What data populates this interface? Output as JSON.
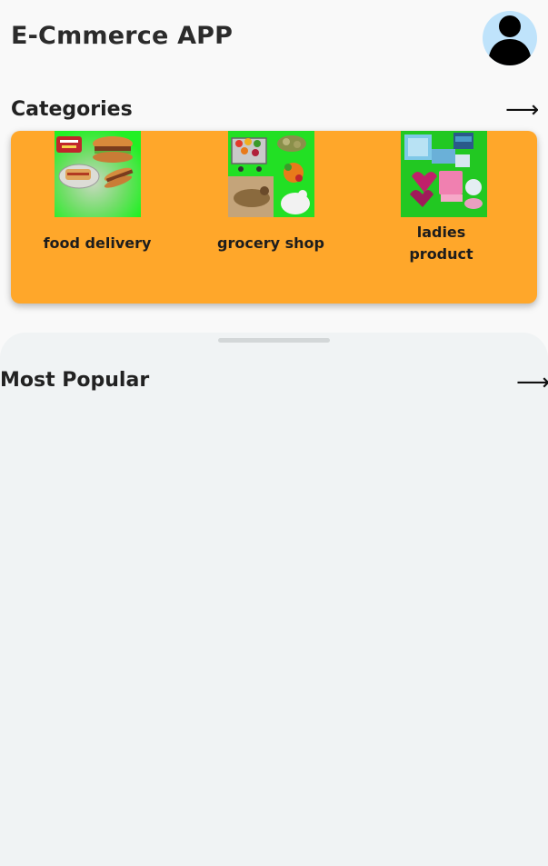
{
  "header": {
    "title": "E-Cmmerce APP",
    "avatar_icon": "user-avatar-icon"
  },
  "categories": {
    "title": "Categories",
    "arrow": "⟶",
    "panel_color": "#ffa72a",
    "items": [
      {
        "label": "food delivery",
        "thumb_color": "#22f024",
        "icon": "food-image"
      },
      {
        "label": "grocery shop",
        "thumb_color": "#22e024",
        "icon": "grocery-image"
      },
      {
        "label": "ladies product",
        "thumb_color": "#22c822",
        "icon": "ladies-product-image"
      }
    ]
  },
  "popular": {
    "title": "Most Popular",
    "arrow": "⟶"
  }
}
